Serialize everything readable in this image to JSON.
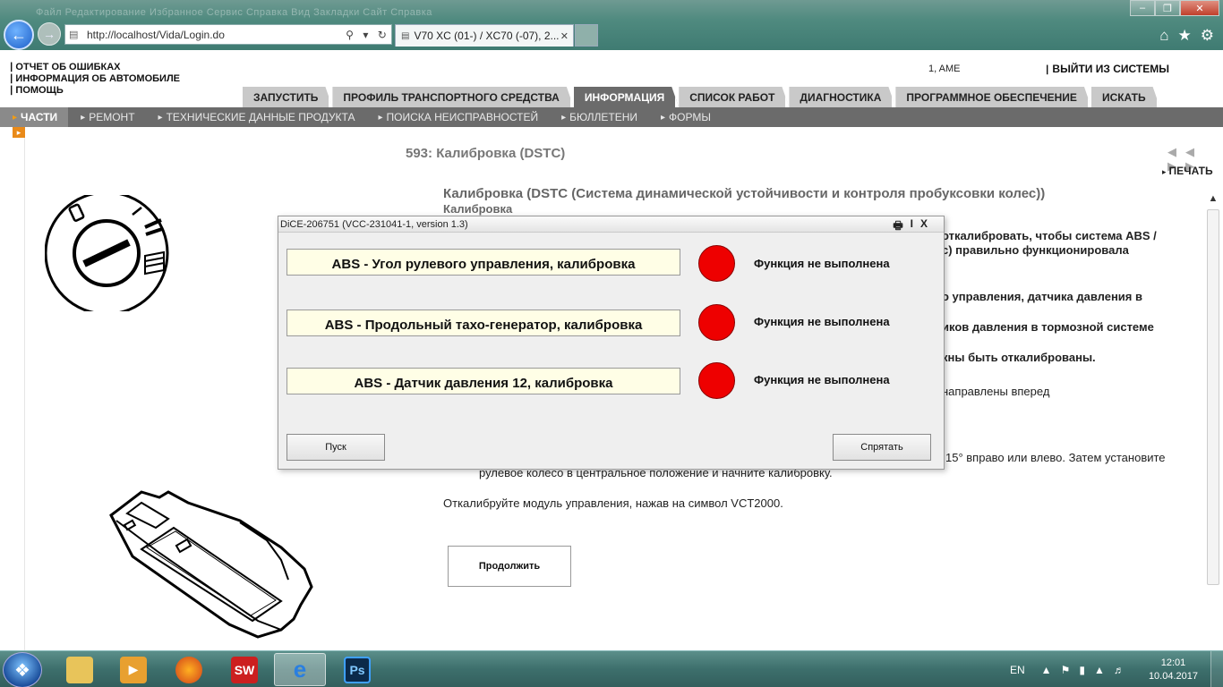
{
  "browser": {
    "menu_hint": "Файл   Редактирование   Избранное   Сервис   Справка   Вид   Закладки   Сайт   Справка",
    "url": "http://localhost/Vida/Login.do",
    "tab_title": "V70 XC (01-) / XC70 (-07), 2...",
    "window_controls": [
      "–",
      "❐",
      "✕"
    ]
  },
  "header": {
    "links": [
      "ОТЧЕТ ОБ ОШИБКАХ",
      "ИНФОРМАЦИЯ ОБ АВТОМОБИЛЕ",
      "ПОМОЩЬ"
    ],
    "user": "1, AME",
    "logout": "ВЫЙТИ ИЗ СИСТЕМЫ",
    "main_tabs": [
      "ЗАПУСТИТЬ",
      "ПРОФИЛЬ ТРАНСПОРТНОГО СРЕДСТВА",
      "ИНФОРМАЦИЯ",
      "СПИСОК РАБОТ",
      "ДИАГНОСТИКА",
      "ПРОГРАММНОЕ ОБЕСПЕЧЕНИЕ",
      "ИСКАТЬ"
    ],
    "active_tab": "ИНФОРМАЦИЯ"
  },
  "subnav": {
    "items": [
      "ЧАСТИ",
      "РЕМОНТ",
      "ТЕХНИЧЕСКИЕ ДАННЫЕ ПРОДУКТА",
      "ПОИСКА НЕИСПРАВНОСТЕЙ",
      "БЮЛЛЕТЕНИ",
      "ФОРМЫ"
    ],
    "active": "ЧАСТИ"
  },
  "page": {
    "title": "593: Калибровка (DSTC)",
    "pager": "◀◀ ▶▶",
    "print": "ПЕЧАТЬ",
    "heading": "Калибровка (DSTC (Система динамической устойчивости и контроля пробуксовки колес))",
    "subheading": "Калибровка",
    "lines": [
      "откалибровать, чтобы система ABS /",
      "с) правильно функционировала",
      "о управления, датчика давления в",
      "иков давления в тормозной системе",
      "кны быть откалиброваны.",
      "направлены вперед",
      "15° вправо или влево. Затем установите",
      "рулевое колесо в центральное положение и начните калибровку.",
      "Откалибруйте модуль управления, нажав на символ VCT2000."
    ],
    "continue_button": "Продолжить"
  },
  "dialog": {
    "title": "DiCE-206751   (VCC-231041-1, version 1.3)",
    "tools": [
      "🖶",
      "I",
      "X"
    ],
    "rows": [
      {
        "label": "ABS - Угол рулевого управления, калибровка",
        "status": "Функция не выполнена",
        "led_color": "#ee0000"
      },
      {
        "label": "ABS - Продольный тахо-генератор, калибровка",
        "status": "Функция не выполнена",
        "led_color": "#ee0000"
      },
      {
        "label": "ABS - Датчик давления 12, калибровка",
        "status": "Функция не выполнена",
        "led_color": "#ee0000"
      }
    ],
    "start_button": "Пуск",
    "hide_button": "Спрятать"
  },
  "taskbar": {
    "apps": [
      "explorer",
      "media-player",
      "firefox",
      "solidworks",
      "internet-explorer",
      "photoshop"
    ],
    "app_labels": {
      "solidworks": "SW",
      "photoshop": "Ps",
      "internet-explorer": "e"
    },
    "lang": "EN",
    "time": "12:01",
    "date": "10.04.2017"
  }
}
